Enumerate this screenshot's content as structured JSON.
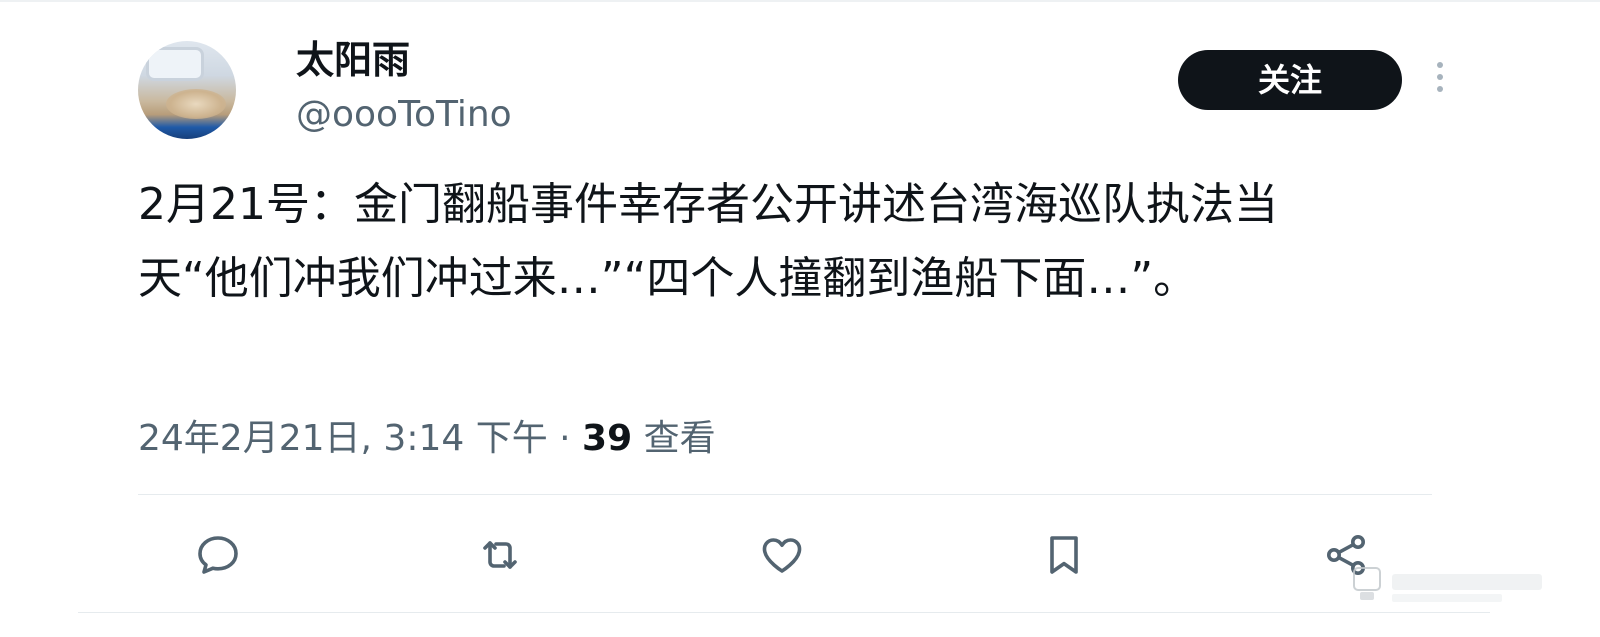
{
  "author": {
    "display_name": "太阳雨",
    "handle": "@oooToTino"
  },
  "follow_button": {
    "label": "关注"
  },
  "tweet": {
    "text": "2月21号：金门翻船事件幸存者公开讲述台湾海巡队执法当天“他们冲我们冲过来…”“四个人撞翻到渔船下面…”。"
  },
  "meta": {
    "timestamp": "24年2月21日, 3:14 下午 · ",
    "views_count": "39",
    "views_label": " 查看"
  },
  "actions": [
    {
      "name": "reply",
      "icon": "reply-icon"
    },
    {
      "name": "retweet",
      "icon": "retweet-icon"
    },
    {
      "name": "like",
      "icon": "heart-icon"
    },
    {
      "name": "bookmark",
      "icon": "bookmark-icon"
    },
    {
      "name": "share",
      "icon": "share-icon"
    }
  ],
  "colors": {
    "text_primary": "#0f1419",
    "text_secondary": "#536471",
    "icon": "#536471",
    "follow_bg": "#0f1419",
    "divider": "#e6ebee"
  }
}
